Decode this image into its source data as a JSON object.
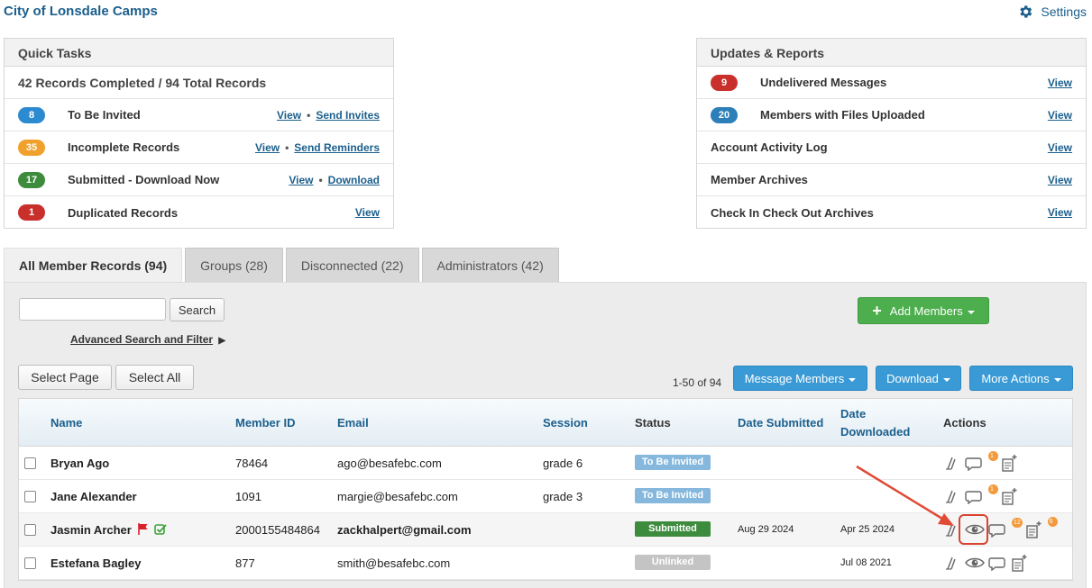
{
  "app": {
    "title": "City of Lonsdale Camps",
    "settings_label": "Settings"
  },
  "quick_tasks": {
    "title": "Quick Tasks",
    "summary": "42 Records Completed / 94 Total Records",
    "rows": [
      {
        "count": "8",
        "color": "#2c8ad1",
        "label": "To Be Invited",
        "link1": "View",
        "link2": "Send Invites"
      },
      {
        "count": "35",
        "color": "#f0a12b",
        "label": "Incomplete Records",
        "link1": "View",
        "link2": "Send Reminders"
      },
      {
        "count": "17",
        "color": "#3d8b3d",
        "label": "Submitted - Download Now",
        "link1": "View",
        "link2": "Download"
      },
      {
        "count": "1",
        "color": "#c9302c",
        "label": "Duplicated Records",
        "link1": "View"
      }
    ]
  },
  "updates": {
    "title": "Updates & Reports",
    "rows": [
      {
        "count": "9",
        "color": "#c9302c",
        "label": "Undelivered Messages",
        "link": "View"
      },
      {
        "count": "20",
        "color": "#2c7fb8",
        "label": "Members with Files Uploaded",
        "link": "View"
      },
      {
        "label": "Account Activity Log",
        "link": "View"
      },
      {
        "label": "Member Archives",
        "link": "View"
      },
      {
        "label": "Check In Check Out Archives",
        "link": "View"
      }
    ]
  },
  "tabs": [
    "All Member Records (94)",
    "Groups (28)",
    "Disconnected (22)",
    "Administrators (42)"
  ],
  "toolbar": {
    "search_placeholder": "",
    "search_button": "Search",
    "advanced_search": "Advanced Search and Filter",
    "advanced_arrow": "▶",
    "add_members": "Add Members",
    "select_page": "Select Page",
    "select_all": "Select All",
    "count": "1-50 of 94",
    "message_members": "Message Members",
    "download": "Download",
    "more_actions": "More Actions"
  },
  "table": {
    "headers": {
      "name": "Name",
      "member_id": "Member ID",
      "email": "Email",
      "session": "Session",
      "status": "Status",
      "date_submitted": "Date Submitted",
      "date_downloaded_1": "Date",
      "date_downloaded_2": "Downloaded",
      "actions": "Actions"
    },
    "rows": [
      {
        "name": "Bryan Ago",
        "member_id": "78464",
        "email": "ago@besafebc.com",
        "session": "grade 6",
        "status": "To Be Invited",
        "status_color": "#85b8dc",
        "date_submitted": "",
        "date_downloaded": "",
        "msg_badge": "1",
        "doc_badge": ""
      },
      {
        "name": "Jane Alexander",
        "member_id": "1091",
        "email": "margie@besafebc.com",
        "session": "grade 3",
        "status": "To Be Invited",
        "status_color": "#85b8dc",
        "date_submitted": "",
        "date_downloaded": "",
        "msg_badge": "1",
        "doc_badge": ""
      },
      {
        "name": "Jasmin Archer",
        "member_id": "2000155484864",
        "email": "zackhalpert@gmail.com",
        "session": "",
        "status": "Submitted",
        "status_color": "#3d8b3d",
        "date_submitted": "Aug 29 2024",
        "date_downloaded": "Apr 25 2024",
        "msg_badge": "12",
        "doc_badge": "6"
      },
      {
        "name": "Estefana Bagley",
        "member_id": "877",
        "email": "smith@besafebc.com",
        "session": "",
        "status": "Unlinked",
        "status_color": "#c4c4c4",
        "date_submitted": "",
        "date_downloaded": "Jul 08 2021",
        "msg_badge": "",
        "doc_badge": ""
      }
    ]
  }
}
